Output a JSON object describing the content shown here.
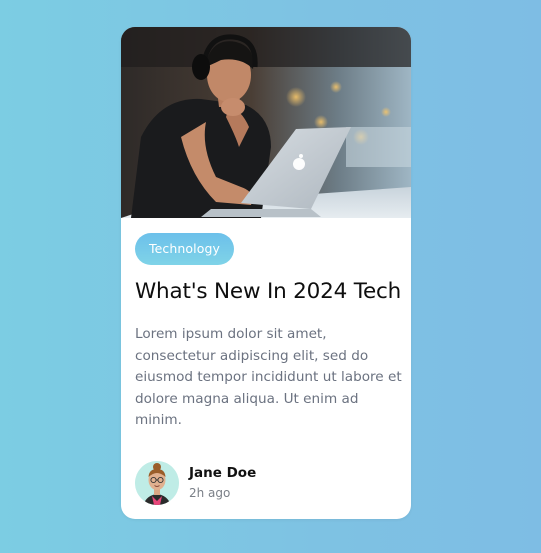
{
  "card": {
    "hero_image": "man-with-headphones-using-laptop-photo",
    "tag": "Technology",
    "title": "What's New In 2024 Tech",
    "excerpt": "Lorem ipsum dolor sit amet, consectetur adipiscing elit, sed do eiusmod tempor incididunt ut labore et dolore magna aliqua. Ut enim ad minim.",
    "author": {
      "name": "Jane Doe",
      "time": "2h ago",
      "avatar_icon": "female-avatar-illustration"
    }
  },
  "colors": {
    "background_start": "#7ccde3",
    "background_end": "#7ebde4",
    "tag_start": "#6cc0ea",
    "tag_end": "#7fd3e8",
    "card_bg": "#ffffff",
    "title_color": "#0e0e0e",
    "excerpt_color": "#6b7280"
  }
}
